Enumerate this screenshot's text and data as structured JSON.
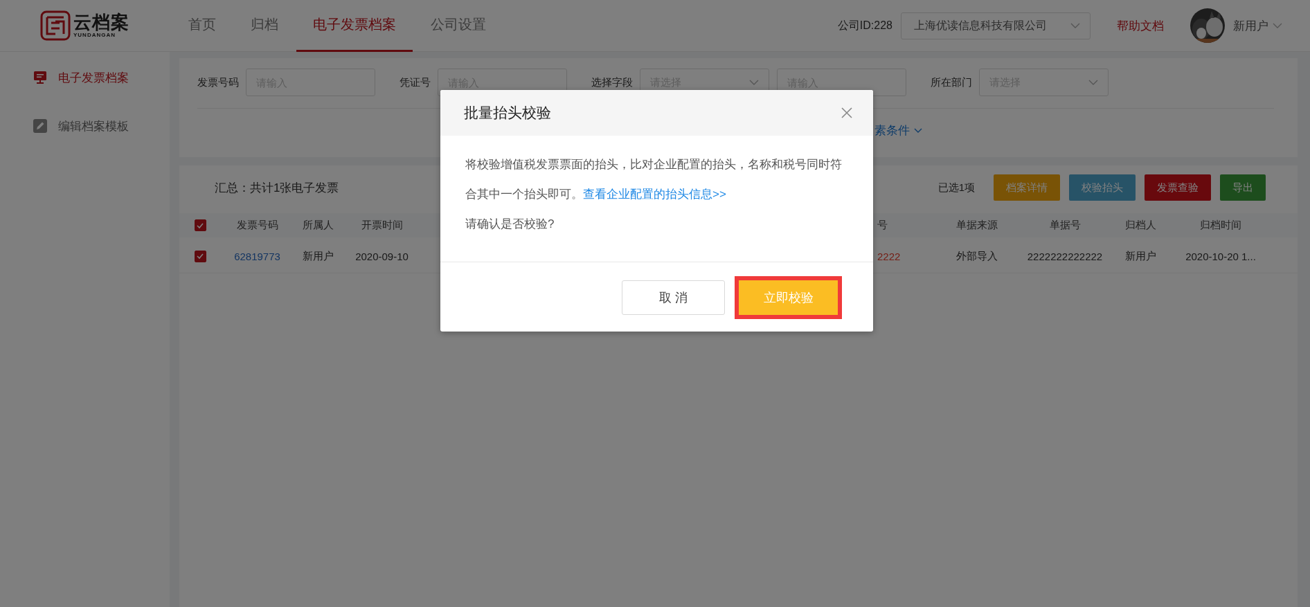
{
  "logo": {
    "name": "云档案",
    "subtitle": "YUNDANGAN"
  },
  "nav": [
    {
      "label": "首页",
      "selected": false
    },
    {
      "label": "归档",
      "selected": false
    },
    {
      "label": "电子发票档案",
      "selected": true
    },
    {
      "label": "公司设置",
      "selected": false
    }
  ],
  "header": {
    "company_id": "公司ID:228",
    "company_select": "上海优读信息科技有限公司",
    "help_link": "帮助文档",
    "user": "新用户"
  },
  "sidebar": {
    "items": [
      {
        "label": "电子发票档案",
        "selected": true
      },
      {
        "label": "编辑档案模板",
        "selected": false
      }
    ]
  },
  "filters": {
    "fields": [
      {
        "kind": "input",
        "label": "发票号码",
        "placeholder": "请输入"
      },
      {
        "kind": "input",
        "label": "凭证号",
        "placeholder": "请输入"
      },
      {
        "kind": "select",
        "label": "选择字段",
        "placeholder": "请选择"
      },
      {
        "kind": "input",
        "placeholder": "请输入"
      },
      {
        "kind": "select",
        "label": "所在部门",
        "placeholder": "请选择"
      }
    ],
    "toggle": "素条件"
  },
  "summary": "汇总：共计1张电子发票",
  "selected_count": "已选1项",
  "actions": [
    {
      "label": "档案详情",
      "kind": "warning"
    },
    {
      "label": "校验抬头",
      "kind": "info"
    },
    {
      "label": "发票查验",
      "kind": "danger"
    },
    {
      "label": "导出",
      "kind": "success"
    }
  ],
  "table": {
    "header_checked": true,
    "columns": [
      "发票号码",
      "所属人",
      "开票时间",
      "号",
      "单据来源",
      "单据号",
      "归档人",
      "归档时间"
    ],
    "rows": [
      {
        "checked": true,
        "cells": [
          {
            "text": "62819773",
            "kind": "link"
          },
          {
            "text": "新用户",
            "kind": "plain"
          },
          {
            "text": "2020-09-10",
            "kind": "plain"
          },
          {
            "text": "2222",
            "kind": "alert"
          },
          {
            "text": "外部导入",
            "kind": "plain"
          },
          {
            "text": "2222222222222",
            "kind": "plain"
          },
          {
            "text": "新用户",
            "kind": "plain"
          },
          {
            "text": "2020-10-20 1...",
            "kind": "plain"
          }
        ]
      }
    ]
  },
  "modal": {
    "title": "批量抬头校验",
    "message": "将校验增值税发票票面的抬头，比对企业配置的抬头，名称和税号同时符合其中一个抬头即可。",
    "link": "查看企业配置的抬头信息>>",
    "question": "请确认是否校验?",
    "buttons": [
      {
        "label": "取 消",
        "kind": "secondary",
        "highlighted": false
      },
      {
        "label": "立即校验",
        "kind": "primary",
        "highlighted": true
      }
    ]
  }
}
